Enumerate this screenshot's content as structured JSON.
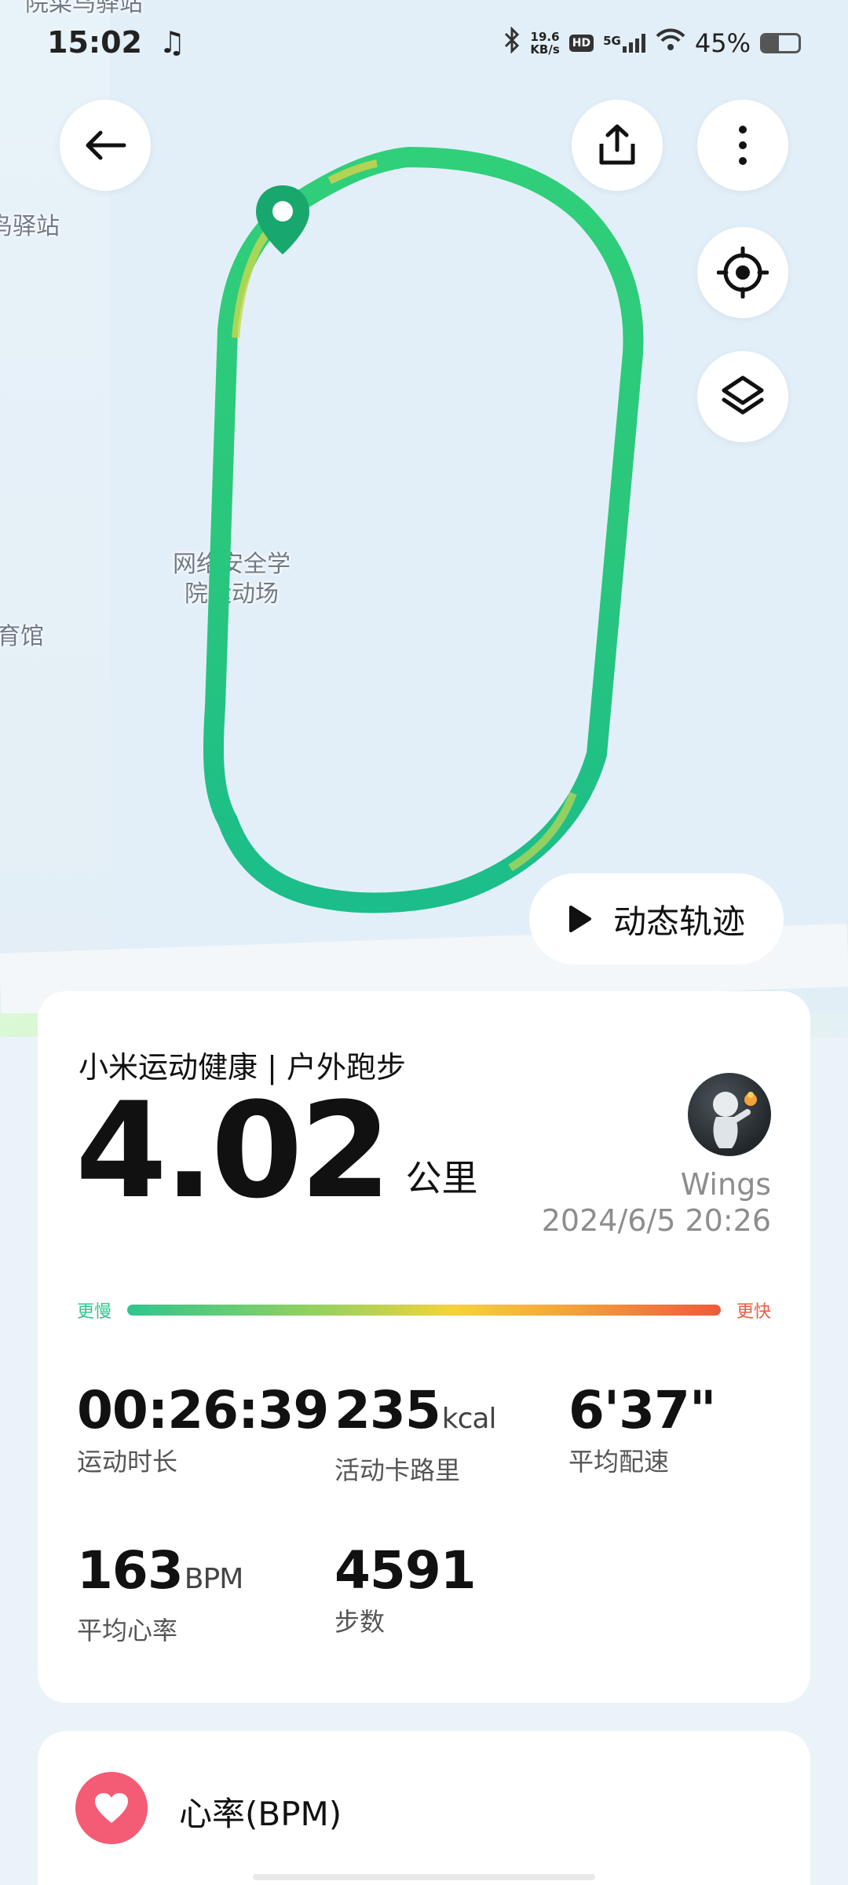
{
  "status_bar": {
    "time": "15:02",
    "net_speed_value": "19.6",
    "net_speed_unit": "KB/s",
    "hd_label": "HD",
    "network": "5G",
    "battery_text": "45%",
    "battery_level": 0.45
  },
  "map": {
    "labels": [
      "院菜鸟驿站",
      "鸟驿站",
      "网络安全学",
      "院运动场",
      "育馆"
    ],
    "route_colors": [
      "#1dc38a",
      "#2fcf78",
      "#a9d95a",
      "#e8d84e"
    ],
    "start_pin_color": "#18a86d"
  },
  "controls": {
    "back_icon": "back-arrow-icon",
    "share_icon": "share-icon",
    "more_icon": "more-vertical-icon",
    "locate_icon": "locate-icon",
    "layers_icon": "layers-icon",
    "dynamic_track_label": "动态轨迹"
  },
  "summary": {
    "app_title": "小米运动健康 | 户外跑步",
    "distance": "4.02",
    "distance_unit": "公里",
    "user_name": "Wings",
    "date": "2024/6/5 20:26",
    "pace_slow_label": "更慢",
    "pace_fast_label": "更快",
    "pace_slow_color": "#2ec68f",
    "pace_fast_color": "#ee5a3c",
    "metrics": [
      {
        "value": "00:26:39",
        "unit": "",
        "label": "运动时长"
      },
      {
        "value": "235",
        "unit": "kcal",
        "label": "活动卡路里"
      },
      {
        "value": "6'37\"",
        "unit": "",
        "label": "平均配速"
      },
      {
        "value": "163",
        "unit": "BPM",
        "label": "平均心率"
      },
      {
        "value": "4591",
        "unit": "",
        "label": "步数"
      }
    ]
  },
  "heart_card": {
    "title": "心率(BPM)",
    "accent_color": "#f45b74"
  }
}
